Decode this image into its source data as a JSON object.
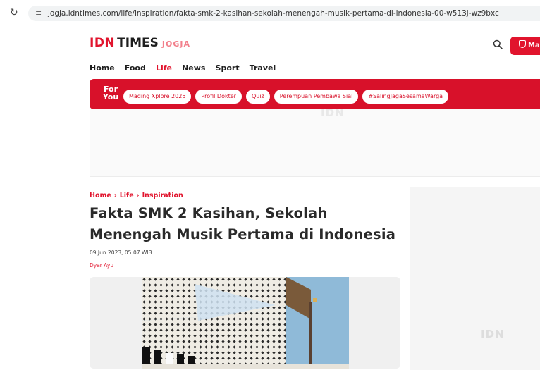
{
  "browser": {
    "url": "jogja.idntimes.com/life/inspiration/fakta-smk-2-kasihan-sekolah-menengah-musik-pertama-di-indonesia-00-w513j-wz9bxc",
    "reload_icon": "reload-icon",
    "site_info_icon": "tune-icon"
  },
  "header": {
    "logo": {
      "idn": "IDN",
      "times": "TIMES",
      "city": "JOGJA"
    },
    "login_label": "Mas"
  },
  "nav": {
    "items": [
      {
        "label": "Home"
      },
      {
        "label": "Food"
      },
      {
        "label": "Life"
      },
      {
        "label": "News"
      },
      {
        "label": "Sport"
      },
      {
        "label": "Travel"
      }
    ],
    "active": "Life"
  },
  "for_you": {
    "label_line1": "For",
    "label_line2": "You",
    "tags": [
      "Mading Xplore 2025",
      "Profil Dokter",
      "Quiz",
      "Perempuan Pembawa Sial",
      "#SalingJagaSesamaWarga"
    ]
  },
  "ad": {
    "watermark": "IDN"
  },
  "breadcrumb": [
    "Home",
    "Life",
    "Inspiration"
  ],
  "article": {
    "title": "Fakta SMK 2 Kasihan, Sekolah Menengah Musik Pertama di Indonesia",
    "date": "09 Jun 2023, 05:07 WIB",
    "author": "Dyar Ayu"
  },
  "sidebar": {
    "watermark": "IDN"
  },
  "colors": {
    "brand_red": "#e1142d",
    "foryou_bg": "#d8112a"
  }
}
